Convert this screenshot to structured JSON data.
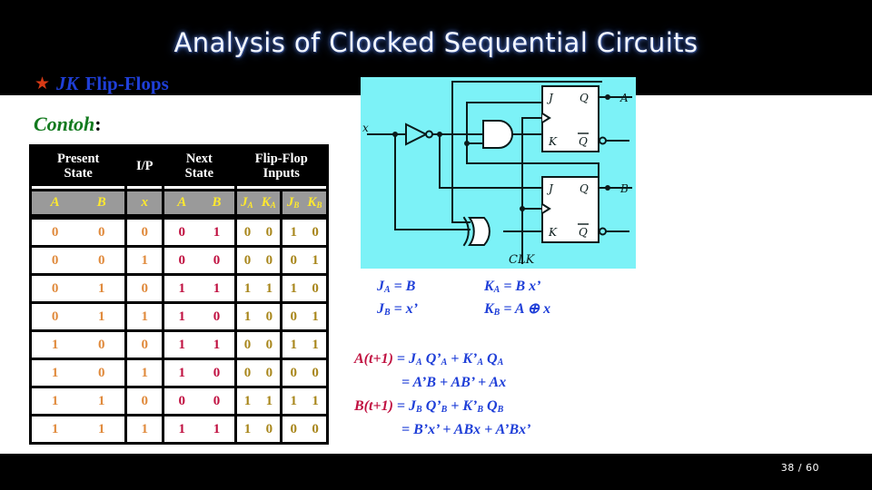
{
  "header": {
    "title": "Analysis of Clocked Sequential Circuits",
    "bullet_icon": "star-icon",
    "subtitle_emphasis": "JK",
    "subtitle_text": "Flip-Flops",
    "band_color": "#000000",
    "title_color": "#f2f6ff",
    "subtitle_color": "#1f3fd8",
    "bullet_color": "#d83a15"
  },
  "example": {
    "label": "Contoh",
    "colon": ":",
    "color": "#137a1f"
  },
  "table": {
    "group_headers": [
      {
        "line1": "Present",
        "line2": "State"
      },
      {
        "line1": "I/P",
        "line2": ""
      },
      {
        "line1": "Next",
        "line2": "State"
      },
      {
        "line1": "Flip-Flop",
        "line2": "Inputs"
      }
    ],
    "sub_headers": {
      "present_state": [
        "A",
        "B"
      ],
      "input": [
        "x"
      ],
      "next_state": [
        "A",
        "B"
      ],
      "ff_a": [
        {
          "base": "J",
          "sub": "A"
        },
        {
          "base": "K",
          "sub": "A"
        }
      ],
      "ff_b": [
        {
          "base": "J",
          "sub": "B"
        },
        {
          "base": "K",
          "sub": "B"
        }
      ]
    },
    "rows": [
      {
        "present": [
          "0",
          "0"
        ],
        "input": [
          "0"
        ],
        "next": [
          "0",
          "1"
        ],
        "ffa": [
          "0",
          "0"
        ],
        "ffb": [
          "1",
          "0"
        ]
      },
      {
        "present": [
          "0",
          "0"
        ],
        "input": [
          "1"
        ],
        "next": [
          "0",
          "0"
        ],
        "ffa": [
          "0",
          "0"
        ],
        "ffb": [
          "0",
          "1"
        ]
      },
      {
        "present": [
          "0",
          "1"
        ],
        "input": [
          "0"
        ],
        "next": [
          "1",
          "1"
        ],
        "ffa": [
          "1",
          "1"
        ],
        "ffb": [
          "1",
          "0"
        ]
      },
      {
        "present": [
          "0",
          "1"
        ],
        "input": [
          "1"
        ],
        "next": [
          "1",
          "0"
        ],
        "ffa": [
          "1",
          "0"
        ],
        "ffb": [
          "0",
          "1"
        ]
      },
      {
        "present": [
          "1",
          "0"
        ],
        "input": [
          "0"
        ],
        "next": [
          "1",
          "1"
        ],
        "ffa": [
          "0",
          "0"
        ],
        "ffb": [
          "1",
          "1"
        ]
      },
      {
        "present": [
          "1",
          "0"
        ],
        "input": [
          "1"
        ],
        "next": [
          "1",
          "0"
        ],
        "ffa": [
          "0",
          "0"
        ],
        "ffb": [
          "0",
          "0"
        ]
      },
      {
        "present": [
          "1",
          "1"
        ],
        "input": [
          "0"
        ],
        "next": [
          "0",
          "0"
        ],
        "ffa": [
          "1",
          "1"
        ],
        "ffb": [
          "1",
          "1"
        ]
      },
      {
        "present": [
          "1",
          "1"
        ],
        "input": [
          "1"
        ],
        "next": [
          "1",
          "1"
        ],
        "ffa": [
          "1",
          "0"
        ],
        "ffb": [
          "0",
          "0"
        ]
      }
    ],
    "colors": {
      "header_bg": "#000000",
      "header_text": "#ffffff",
      "subheader_bg": "#9a9a9a",
      "subheader_text": "#ffe92e",
      "present_state_text": "#e08a3c",
      "next_state_text": "#c01040",
      "ff_input_text": "#a8861b"
    }
  },
  "circuit": {
    "background_color": "#7cf2f7",
    "input_label": "x",
    "clock_label": "CLK",
    "output_a": "A",
    "output_b": "B",
    "flipflops": [
      {
        "j": "J",
        "k": "K",
        "q": "Q",
        "qbar": "Q"
      },
      {
        "j": "J",
        "k": "K",
        "q": "Q",
        "qbar": "Q"
      }
    ],
    "gates": [
      "inverter",
      "and-gate",
      "xor-gate"
    ]
  },
  "jk_equations": {
    "ja": {
      "lhs_base": "J",
      "lhs_sub": "A",
      "rhs": "= B"
    },
    "ka": {
      "lhs_base": "K",
      "lhs_sub": "A",
      "rhs": "= B x’"
    },
    "jb": {
      "lhs_base": "J",
      "lhs_sub": "B",
      "rhs": "= x’"
    },
    "kb": {
      "lhs_base": "K",
      "lhs_sub": "B",
      "rhs": "= A ⊕ x"
    },
    "color": "#1f3fd8"
  },
  "derivations": {
    "a_next": {
      "lhs": "A(t+1)",
      "rhs_main": "= J",
      "rhs_full": "= J_A Q’_A + K’_A Q_A",
      "rhs_simplified": "= A’B + AB’ + Ax"
    },
    "b_next": {
      "lhs": "B(t+1)",
      "rhs_full": "= J_B Q’_B + K’_B Q_B",
      "rhs_simplified": "= B’x’ + ABx + A’Bx’"
    },
    "lhs_color": "#c01040",
    "rhs_color": "#1f3fd8"
  },
  "footer": {
    "page_number": "38 / 60",
    "band_color": "#000000"
  }
}
